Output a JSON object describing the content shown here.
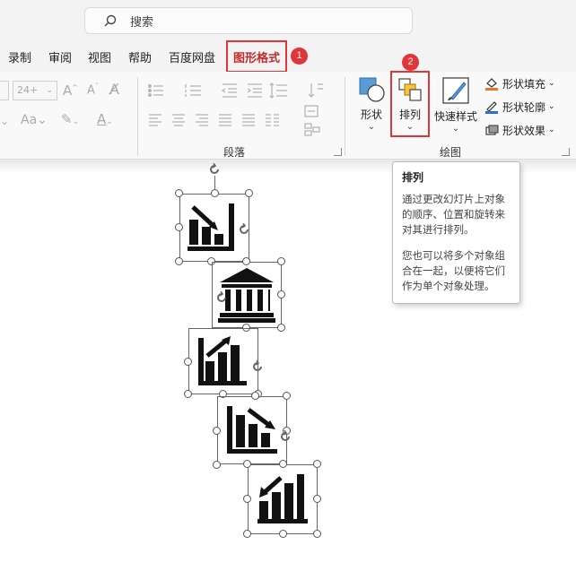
{
  "search": {
    "placeholder": "搜索"
  },
  "tabs": [
    {
      "label": "录制"
    },
    {
      "label": "审阅"
    },
    {
      "label": "视图"
    },
    {
      "label": "帮助"
    },
    {
      "label": "百度网盘"
    },
    {
      "label": "图形格式"
    }
  ],
  "badges": {
    "one": "1",
    "two": "2"
  },
  "font": {
    "size_value": "24+"
  },
  "groups": {
    "paragraph": "段落",
    "drawing": "绘图"
  },
  "buttons": {
    "shape": "形状",
    "arrange": "排列",
    "quick_style": "快速样式",
    "shape_fill": "形状填充",
    "shape_outline": "形状轮廓",
    "shape_effects": "形状效果"
  },
  "tooltip": {
    "title": "排列",
    "p1": "通过更改幻灯片上对象的顺序、位置和旋转来对其进行排列。",
    "p2": "您也可以将多个对象组合在一起，以便将它们作为单个对象处理。"
  },
  "colors": {
    "accent_red": "#e0353b",
    "active_tab": "#c22b2b",
    "fill_orange": "#e8732a",
    "outline_blue": "#2b6fd6"
  }
}
